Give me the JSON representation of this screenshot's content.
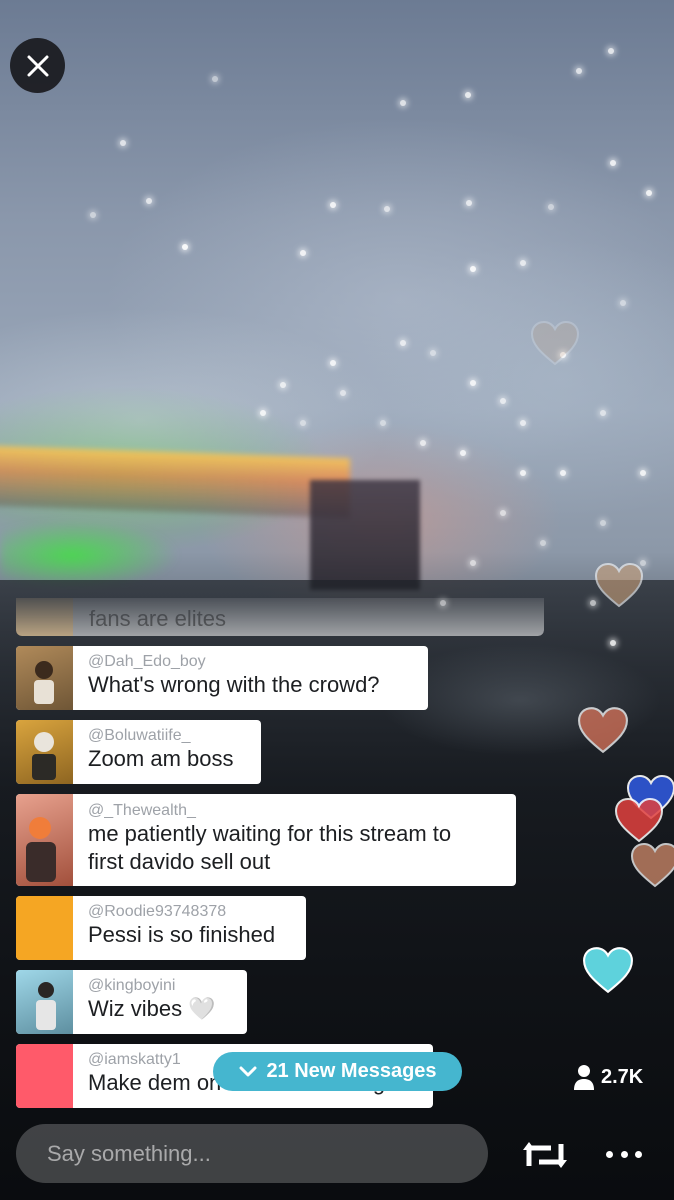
{
  "chat": {
    "faded_message": {
      "text": "fans are elites"
    },
    "messages": [
      {
        "handle": "@Dah_Edo_boy",
        "text": "What's wrong with the crowd?",
        "avatar_color": "#8f7048"
      },
      {
        "handle": "@Boluwatiife_",
        "text": "Zoom am boss",
        "avatar_color": "#c4913a"
      },
      {
        "handle": "@_Thewealth_",
        "text_line1": "me patiently waiting for this stream to",
        "text_line2": "first davido sell out",
        "avatar_color": "#d07a64"
      },
      {
        "handle": "@Roodie93748378",
        "text": "Pessi is so finished",
        "avatar_color": "#f5a623"
      },
      {
        "handle": "@kingboyini",
        "text": "Wiz vibes 🤍",
        "avatar_color": "#7fb6c6"
      },
      {
        "handle": "@iamskatty1",
        "text": "Make dem on comments Abeg",
        "avatar_color": "#ff5a6a"
      }
    ],
    "new_messages_label": "21 New Messages",
    "new_messages_color": "#45b6cf"
  },
  "viewers": {
    "count": "2.7K"
  },
  "composer": {
    "placeholder": "Say something..."
  },
  "icons": {
    "close": "close-icon",
    "chevron": "chevron-down-icon",
    "person": "person-icon",
    "retweet": "retweet-icon",
    "more": "more-icon"
  },
  "hearts": [
    {
      "color": "#c9a07a"
    },
    {
      "color": "#c9a07a"
    },
    {
      "color": "#d9745a"
    },
    {
      "color": "#2f57d8"
    },
    {
      "color": "#e0403e"
    },
    {
      "color": "#d08a6a"
    },
    {
      "color": "#5ed2dc"
    }
  ]
}
